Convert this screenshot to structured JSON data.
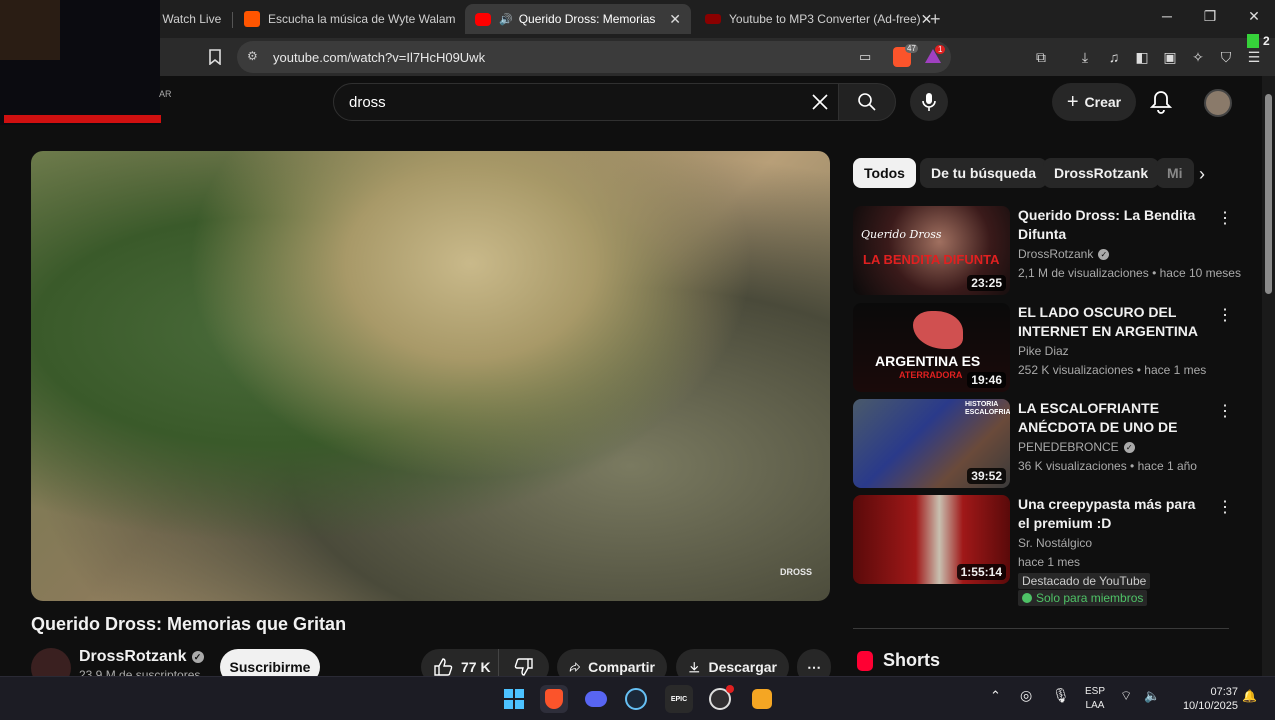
{
  "browser": {
    "tabs": [
      {
        "label": "- Watch Live",
        "active": false
      },
      {
        "label": "Escucha la música de Wyte Walam | D",
        "active": false
      },
      {
        "label": "Querido Dross: Memorias que",
        "active": true
      },
      {
        "label": "Youtube to MP3 Converter (Ad-free)",
        "active": false
      }
    ],
    "new_tab": "+",
    "url": "youtube.com/watch?v=Il7HcH09Uwk",
    "brave_badge": "47",
    "alert_badge": "1",
    "ext_badge": "2"
  },
  "webcam": {
    "label": "AR"
  },
  "youtube": {
    "search_query": "dross",
    "create_label": "Crear",
    "video": {
      "title": "Querido Dross: Memorias que Gritan",
      "watermark": "DROSS",
      "channel": "DrossRotzank",
      "subscribers": "23,9 M de suscriptores",
      "subscribe_label": "Suscribirme",
      "likes": "77 K",
      "share_label": "Compartir",
      "download_label": "Descargar",
      "more": "⋯"
    },
    "chips": [
      "Todos",
      "De tu búsqueda",
      "DrossRotzank",
      "Mi"
    ],
    "recommendations": [
      {
        "title": "Querido Dross: La Bendita Difunta",
        "channel": "DrossRotzank",
        "verified": true,
        "meta": "2,1 M de visualizaciones • hace 10 meses",
        "duration": "23:25",
        "thumb_text": "LA BENDITA DIFUNTA",
        "thumb_script": "Querido Dross"
      },
      {
        "title": "EL LADO OSCURO DEL INTERNET EN ARGENTINA",
        "channel": "Pike Diaz",
        "verified": false,
        "meta": "252 K visualizaciones • hace 1 mes",
        "duration": "19:46",
        "thumb_text": "ARGENTINA ES",
        "thumb_sub": "ATERRADORA"
      },
      {
        "title": "LA ESCALOFRIANTE ANÉCDOTA DE UNO DE LOS ...",
        "channel": "PENEDEBRONCE",
        "verified": true,
        "meta": "36 K visualizaciones • hace 1 año",
        "duration": "39:52",
        "thumb_text": "HISTORIA ESCALOFRIANTE"
      },
      {
        "title": "Una creepypasta más para el premium :D",
        "channel": "Sr. Nostálgico",
        "verified": false,
        "meta": "hace 1 mes",
        "duration": "1:55:14",
        "badge1": "Destacado de YouTube",
        "badge2": "Solo para miembros"
      }
    ],
    "shorts_label": "Shorts"
  },
  "taskbar": {
    "lang_top": "ESP",
    "lang_bottom": "LAA",
    "time": "07:37",
    "date": "10/10/2025",
    "epic_label": "EPIC"
  }
}
